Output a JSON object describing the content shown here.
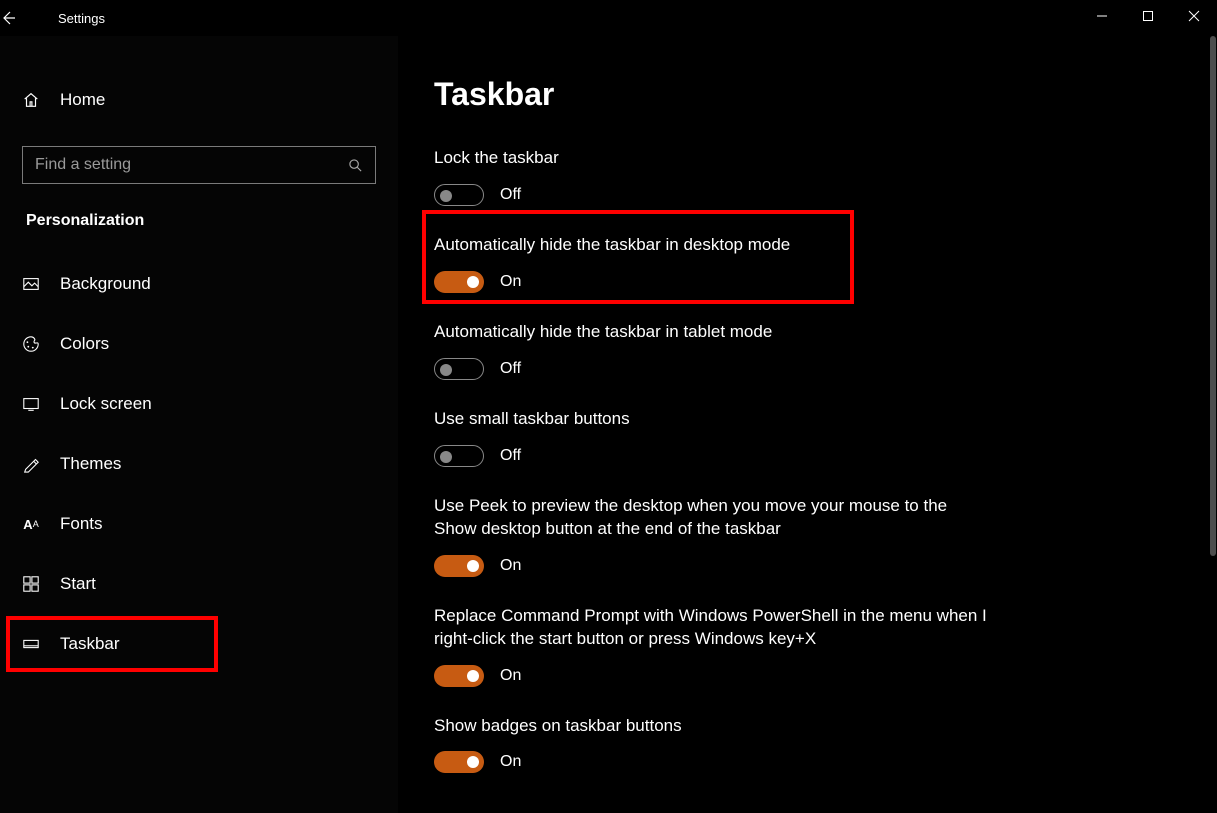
{
  "window": {
    "title": "Settings"
  },
  "sidebar": {
    "home": "Home",
    "search_placeholder": "Find a setting",
    "category": "Personalization",
    "items": [
      {
        "label": "Background"
      },
      {
        "label": "Colors"
      },
      {
        "label": "Lock screen"
      },
      {
        "label": "Themes"
      },
      {
        "label": "Fonts"
      },
      {
        "label": "Start"
      },
      {
        "label": "Taskbar"
      }
    ]
  },
  "page": {
    "title": "Taskbar",
    "settings": [
      {
        "label": "Lock the taskbar",
        "on": false,
        "state": "Off"
      },
      {
        "label": "Automatically hide the taskbar in desktop mode",
        "on": true,
        "state": "On"
      },
      {
        "label": "Automatically hide the taskbar in tablet mode",
        "on": false,
        "state": "Off"
      },
      {
        "label": "Use small taskbar buttons",
        "on": false,
        "state": "Off"
      },
      {
        "label": "Use Peek to preview the desktop when you move your mouse to the Show desktop button at the end of the taskbar",
        "on": true,
        "state": "On"
      },
      {
        "label": "Replace Command Prompt with Windows PowerShell in the menu when I right-click the start button or press Windows key+X",
        "on": true,
        "state": "On"
      },
      {
        "label": "Show badges on taskbar buttons",
        "on": true,
        "state": "On"
      }
    ]
  },
  "colors": {
    "accent": "#c75b12",
    "highlight": "#ff0000"
  }
}
